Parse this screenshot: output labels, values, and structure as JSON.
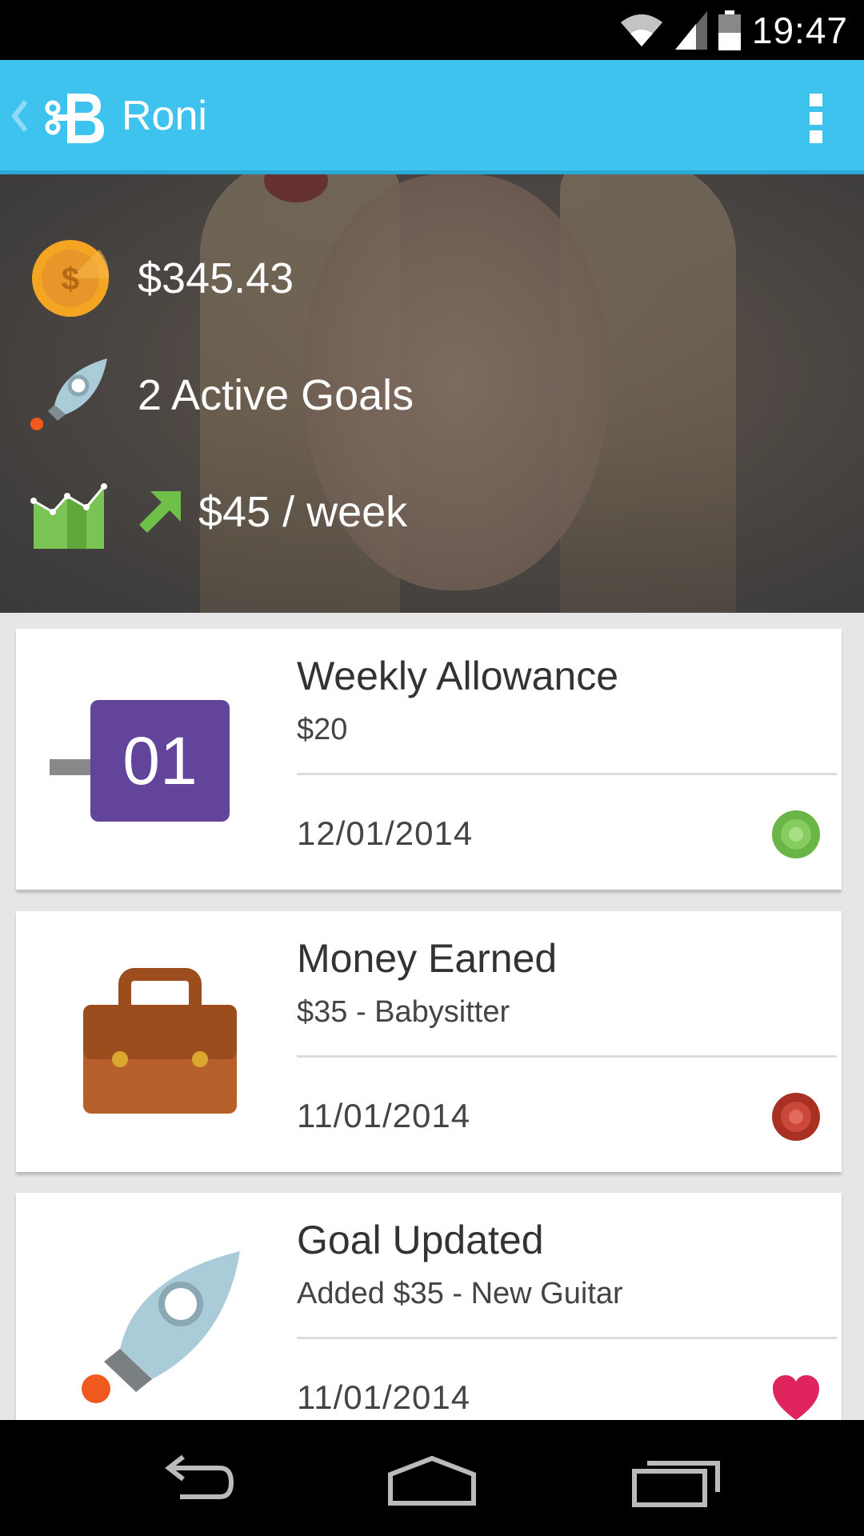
{
  "status_bar": {
    "time": "19:47"
  },
  "app_bar": {
    "title": "Roni"
  },
  "summary": {
    "balance": "$345.43",
    "active_goals": "2 Active Goals",
    "weekly_rate": "$45 / week"
  },
  "cards": [
    {
      "title": "Weekly Allowance",
      "subtitle": "$20",
      "date": "12/01/2014",
      "calendar_day": "01",
      "status_color": "#6ab547"
    },
    {
      "title": "Money Earned",
      "subtitle": "$35 - Babysitter",
      "date": "11/01/2014",
      "status_color": "#c0392b"
    },
    {
      "title": "Goal Updated",
      "subtitle": "Added $35 - New Guitar",
      "date": "11/01/2014",
      "status_color": "#e0245e"
    }
  ],
  "colors": {
    "app_bar": "#3ec3ef",
    "coin": "#f4a623",
    "calendar": "#62449a",
    "briefcase": "#b8602b",
    "rocket": "#a9ccd8"
  },
  "icons": {
    "balance": "coin-icon",
    "goals": "rocket-icon",
    "rate": "chart-icon",
    "trend": "trend-up-arrow-icon",
    "nav_back": "nav-back-icon",
    "nav_home": "nav-home-icon",
    "nav_recents": "nav-recents-icon"
  }
}
